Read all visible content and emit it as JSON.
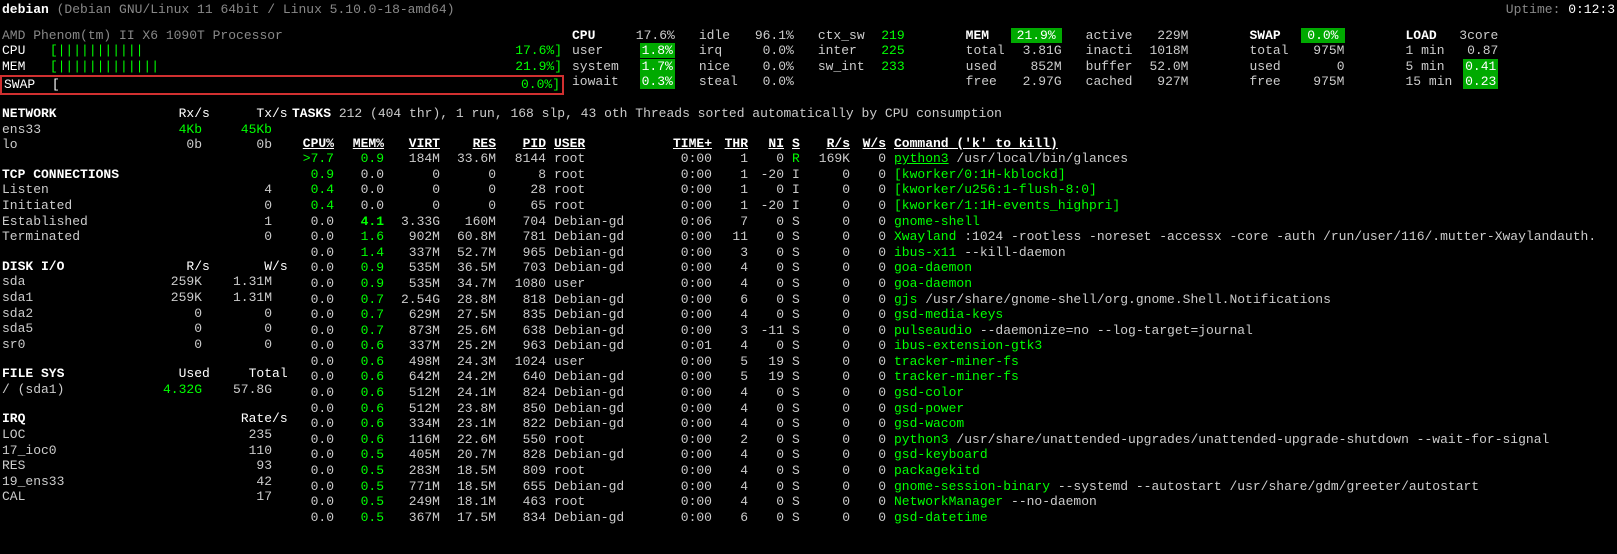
{
  "header": {
    "host": "debian",
    "os": "(Debian GNU/Linux 11 64bit / Linux 5.10.0-18-amd64)",
    "uptime_label": "Uptime:",
    "uptime": "0:12:3"
  },
  "cpu_info": {
    "model": "AMD Phenom(tm) II X6 1090T Processor",
    "cpu_label": "CPU",
    "cpu_bar": "[|||||||||||",
    "cpu_tail": "17.6%]",
    "mem_label": "MEM",
    "mem_bar": "[|||||||||||||",
    "mem_tail": "21.9%]",
    "swap_label": "SWAP",
    "swap_bar": "[",
    "swap_tail": "0.0%]"
  },
  "cpu": {
    "title": "CPU",
    "total": "17.6%",
    "rows": [
      {
        "k": "user",
        "v": "1.8%",
        "hl": true
      },
      {
        "k": "system",
        "v": "1.7%",
        "hl": true
      },
      {
        "k": "iowait",
        "v": "0.3%",
        "hl": true
      }
    ]
  },
  "cpu2": {
    "rows": [
      {
        "k": "idle",
        "v": "96.1%"
      },
      {
        "k": "irq",
        "v": "0.0%"
      },
      {
        "k": "nice",
        "v": "0.0%"
      },
      {
        "k": "steal",
        "v": "0.0%"
      }
    ]
  },
  "cpu3": {
    "rows": [
      {
        "k": "ctx_sw",
        "v": "219"
      },
      {
        "k": "inter",
        "v": "225"
      },
      {
        "k": "sw_int",
        "v": "233"
      }
    ]
  },
  "mem": {
    "title": "MEM",
    "total": "21.9%",
    "rows": [
      {
        "k": "total",
        "v": "3.81G"
      },
      {
        "k": "used",
        "v": "852M"
      },
      {
        "k": "free",
        "v": "2.97G"
      }
    ]
  },
  "mem2": {
    "rows": [
      {
        "k": "active",
        "v": "229M"
      },
      {
        "k": "inacti",
        "v": "1018M"
      },
      {
        "k": "buffer",
        "v": "52.0M"
      },
      {
        "k": "cached",
        "v": "927M"
      }
    ]
  },
  "swap": {
    "title": "SWAP",
    "total": "0.0%",
    "rows": [
      {
        "k": "total",
        "v": "975M"
      },
      {
        "k": "used",
        "v": "0"
      },
      {
        "k": "free",
        "v": "975M"
      }
    ]
  },
  "load": {
    "title": "LOAD",
    "core": "3core",
    "rows": [
      {
        "k": "1 min",
        "v": "0.87"
      },
      {
        "k": "5 min",
        "v": "0.41",
        "hl": true
      },
      {
        "k": "15 min",
        "v": "0.23",
        "hl": true
      }
    ]
  },
  "network": {
    "title": "NETWORK",
    "h1": "Rx/s",
    "h2": "Tx/s",
    "rows": [
      {
        "name": "ens33",
        "rx": "4Kb",
        "tx": "45Kb",
        "hl": true
      },
      {
        "name": "lo",
        "rx": "0b",
        "tx": "0b"
      }
    ]
  },
  "tcp": {
    "title": "TCP CONNECTIONS",
    "rows": [
      {
        "name": "Listen",
        "v": "4"
      },
      {
        "name": "Initiated",
        "v": "0"
      },
      {
        "name": "Established",
        "v": "1"
      },
      {
        "name": "Terminated",
        "v": "0"
      }
    ]
  },
  "disk": {
    "title": "DISK I/O",
    "h1": "R/s",
    "h2": "W/s",
    "rows": [
      {
        "name": "sda",
        "r": "259K",
        "w": "1.31M"
      },
      {
        "name": "sda1",
        "r": "259K",
        "w": "1.31M"
      },
      {
        "name": "sda2",
        "r": "0",
        "w": "0"
      },
      {
        "name": "sda5",
        "r": "0",
        "w": "0"
      },
      {
        "name": "sr0",
        "r": "0",
        "w": "0"
      }
    ]
  },
  "fs": {
    "title": "FILE SYS",
    "h1": "Used",
    "h2": "Total",
    "rows": [
      {
        "name": "/ (sda1)",
        "used": "4.32G",
        "total": "57.8G",
        "hl": true
      }
    ]
  },
  "irq": {
    "title": "IRQ",
    "h1": "Rate/s",
    "rows": [
      {
        "name": "LOC",
        "v": "235"
      },
      {
        "name": "17_ioc0",
        "v": "110"
      },
      {
        "name": "RES",
        "v": "93"
      },
      {
        "name": "19_ens33",
        "v": "42"
      },
      {
        "name": "CAL",
        "v": "17"
      }
    ]
  },
  "tasks_hdr": "TASKS 212 (404 thr), 1 run, 168 slp, 43 oth Threads sorted automatically by CPU consumption",
  "tasks_cols": [
    "CPU%",
    "MEM%",
    "VIRT",
    "RES",
    "PID",
    "USER",
    "TIME+",
    "THR",
    "NI",
    "S",
    "R/s",
    "W/s",
    "Command ('k' to kill)"
  ],
  "tasks": [
    {
      "cpu": ">7.7",
      "mem": "0.9",
      "virt": "184M",
      "res": "33.6M",
      "pid": "8144",
      "user": "root",
      "time": "0:00",
      "thr": "1",
      "ni": "0",
      "s": "R",
      "rs": "169K",
      "ws": "0",
      "cmd": "python3",
      "args": "/usr/local/bin/glances",
      "cpu_hl": true,
      "cmd_u": true
    },
    {
      "cpu": "0.9",
      "mem": "0.0",
      "virt": "0",
      "res": "0",
      "pid": "8",
      "user": "root",
      "time": "0:00",
      "thr": "1",
      "ni": "-20",
      "s": "I",
      "rs": "0",
      "ws": "0",
      "cmd": "[kworker/0:1H-kblockd]"
    },
    {
      "cpu": "0.4",
      "mem": "0.0",
      "virt": "0",
      "res": "0",
      "pid": "28",
      "user": "root",
      "time": "0:00",
      "thr": "1",
      "ni": "0",
      "s": "I",
      "rs": "0",
      "ws": "0",
      "cmd": "[kworker/u256:1-flush-8:0]"
    },
    {
      "cpu": "0.4",
      "mem": "0.0",
      "virt": "0",
      "res": "0",
      "pid": "65",
      "user": "root",
      "time": "0:00",
      "thr": "1",
      "ni": "-20",
      "s": "I",
      "rs": "0",
      "ws": "0",
      "cmd": "[kworker/1:1H-events_highpri]"
    },
    {
      "cpu": "0.0",
      "mem": "4.1",
      "virt": "3.33G",
      "res": "160M",
      "pid": "704",
      "user": "Debian-gd",
      "time": "0:06",
      "thr": "7",
      "ni": "0",
      "s": "S",
      "rs": "0",
      "ws": "0",
      "cmd": "gnome-shell",
      "mem_hl": true
    },
    {
      "cpu": "0.0",
      "mem": "1.6",
      "virt": "902M",
      "res": "60.8M",
      "pid": "781",
      "user": "Debian-gd",
      "time": "0:00",
      "thr": "11",
      "ni": "0",
      "s": "S",
      "rs": "0",
      "ws": "0",
      "cmd": "Xwayland",
      "args": ":1024 -rootless -noreset -accessx -core -auth /run/user/116/.mutter-Xwaylandauth."
    },
    {
      "cpu": "0.0",
      "mem": "1.4",
      "virt": "337M",
      "res": "52.7M",
      "pid": "965",
      "user": "Debian-gd",
      "time": "0:00",
      "thr": "3",
      "ni": "0",
      "s": "S",
      "rs": "0",
      "ws": "0",
      "cmd": "ibus-x11",
      "args": "--kill-daemon"
    },
    {
      "cpu": "0.0",
      "mem": "0.9",
      "virt": "535M",
      "res": "36.5M",
      "pid": "703",
      "user": "Debian-gd",
      "time": "0:00",
      "thr": "4",
      "ni": "0",
      "s": "S",
      "rs": "0",
      "ws": "0",
      "cmd": "goa-daemon"
    },
    {
      "cpu": "0.0",
      "mem": "0.9",
      "virt": "535M",
      "res": "34.7M",
      "pid": "1080",
      "user": "user",
      "time": "0:00",
      "thr": "4",
      "ni": "0",
      "s": "S",
      "rs": "0",
      "ws": "0",
      "cmd": "goa-daemon"
    },
    {
      "cpu": "0.0",
      "mem": "0.7",
      "virt": "2.54G",
      "res": "28.8M",
      "pid": "818",
      "user": "Debian-gd",
      "time": "0:00",
      "thr": "6",
      "ni": "0",
      "s": "S",
      "rs": "0",
      "ws": "0",
      "cmd": "gjs",
      "args": "/usr/share/gnome-shell/org.gnome.Shell.Notifications"
    },
    {
      "cpu": "0.0",
      "mem": "0.7",
      "virt": "629M",
      "res": "27.5M",
      "pid": "835",
      "user": "Debian-gd",
      "time": "0:00",
      "thr": "4",
      "ni": "0",
      "s": "S",
      "rs": "0",
      "ws": "0",
      "cmd": "gsd-media-keys"
    },
    {
      "cpu": "0.0",
      "mem": "0.7",
      "virt": "873M",
      "res": "25.6M",
      "pid": "638",
      "user": "Debian-gd",
      "time": "0:00",
      "thr": "3",
      "ni": "-11",
      "s": "S",
      "rs": "0",
      "ws": "0",
      "cmd": "pulseaudio",
      "args": "--daemonize=no --log-target=journal"
    },
    {
      "cpu": "0.0",
      "mem": "0.6",
      "virt": "337M",
      "res": "25.2M",
      "pid": "963",
      "user": "Debian-gd",
      "time": "0:01",
      "thr": "4",
      "ni": "0",
      "s": "S",
      "rs": "0",
      "ws": "0",
      "cmd": "ibus-extension-gtk3"
    },
    {
      "cpu": "0.0",
      "mem": "0.6",
      "virt": "498M",
      "res": "24.3M",
      "pid": "1024",
      "user": "user",
      "time": "0:00",
      "thr": "5",
      "ni": "19",
      "s": "S",
      "rs": "0",
      "ws": "0",
      "cmd": "tracker-miner-fs"
    },
    {
      "cpu": "0.0",
      "mem": "0.6",
      "virt": "642M",
      "res": "24.2M",
      "pid": "640",
      "user": "Debian-gd",
      "time": "0:00",
      "thr": "5",
      "ni": "19",
      "s": "S",
      "rs": "0",
      "ws": "0",
      "cmd": "tracker-miner-fs"
    },
    {
      "cpu": "0.0",
      "mem": "0.6",
      "virt": "512M",
      "res": "24.1M",
      "pid": "824",
      "user": "Debian-gd",
      "time": "0:00",
      "thr": "4",
      "ni": "0",
      "s": "S",
      "rs": "0",
      "ws": "0",
      "cmd": "gsd-color"
    },
    {
      "cpu": "0.0",
      "mem": "0.6",
      "virt": "512M",
      "res": "23.8M",
      "pid": "850",
      "user": "Debian-gd",
      "time": "0:00",
      "thr": "4",
      "ni": "0",
      "s": "S",
      "rs": "0",
      "ws": "0",
      "cmd": "gsd-power"
    },
    {
      "cpu": "0.0",
      "mem": "0.6",
      "virt": "334M",
      "res": "23.1M",
      "pid": "822",
      "user": "Debian-gd",
      "time": "0:00",
      "thr": "4",
      "ni": "0",
      "s": "S",
      "rs": "0",
      "ws": "0",
      "cmd": "gsd-wacom"
    },
    {
      "cpu": "0.0",
      "mem": "0.6",
      "virt": "116M",
      "res": "22.6M",
      "pid": "550",
      "user": "root",
      "time": "0:00",
      "thr": "2",
      "ni": "0",
      "s": "S",
      "rs": "0",
      "ws": "0",
      "cmd": "python3",
      "args": "/usr/share/unattended-upgrades/unattended-upgrade-shutdown --wait-for-signal"
    },
    {
      "cpu": "0.0",
      "mem": "0.5",
      "virt": "405M",
      "res": "20.7M",
      "pid": "828",
      "user": "Debian-gd",
      "time": "0:00",
      "thr": "4",
      "ni": "0",
      "s": "S",
      "rs": "0",
      "ws": "0",
      "cmd": "gsd-keyboard"
    },
    {
      "cpu": "0.0",
      "mem": "0.5",
      "virt": "283M",
      "res": "18.5M",
      "pid": "809",
      "user": "root",
      "time": "0:00",
      "thr": "4",
      "ni": "0",
      "s": "S",
      "rs": "0",
      "ws": "0",
      "cmd": "packagekitd"
    },
    {
      "cpu": "0.0",
      "mem": "0.5",
      "virt": "771M",
      "res": "18.5M",
      "pid": "655",
      "user": "Debian-gd",
      "time": "0:00",
      "thr": "4",
      "ni": "0",
      "s": "S",
      "rs": "0",
      "ws": "0",
      "cmd": "gnome-session-binary",
      "args": "--systemd --autostart /usr/share/gdm/greeter/autostart"
    },
    {
      "cpu": "0.0",
      "mem": "0.5",
      "virt": "249M",
      "res": "18.1M",
      "pid": "463",
      "user": "root",
      "time": "0:00",
      "thr": "4",
      "ni": "0",
      "s": "S",
      "rs": "0",
      "ws": "0",
      "cmd": "NetworkManager",
      "args": "--no-daemon"
    },
    {
      "cpu": "0.0",
      "mem": "0.5",
      "virt": "367M",
      "res": "17.5M",
      "pid": "834",
      "user": "Debian-gd",
      "time": "0:00",
      "thr": "6",
      "ni": "0",
      "s": "S",
      "rs": "0",
      "ws": "0",
      "cmd": "gsd-datetime"
    }
  ]
}
